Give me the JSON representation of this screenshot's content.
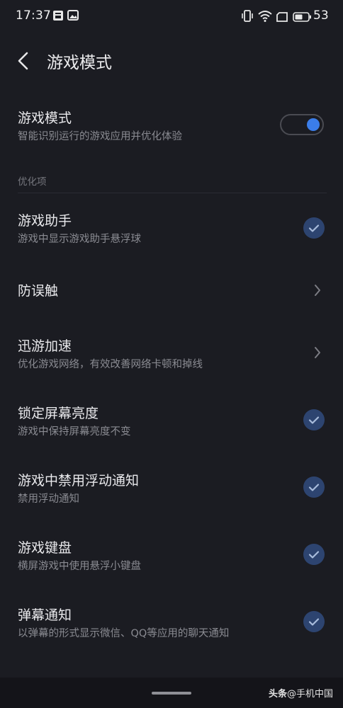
{
  "status_bar": {
    "time": "17:37",
    "battery_level": "53",
    "icons": [
      "notification-app-icon",
      "image-notification-icon",
      "vibrate-icon",
      "wifi-icon",
      "sim-card-icon",
      "battery-icon"
    ]
  },
  "header": {
    "back_icon": "back-arrow-icon",
    "title": "游戏模式"
  },
  "game_mode": {
    "title": "游戏模式",
    "subtitle": "智能识别运行的游戏应用并优化体验",
    "enabled": true
  },
  "section": {
    "label": "优化项"
  },
  "items": [
    {
      "title": "游戏助手",
      "subtitle": "游戏中显示游戏助手悬浮球",
      "control": "check",
      "checked": true
    },
    {
      "title": "防误触",
      "subtitle": "",
      "control": "chevron"
    },
    {
      "title": "迅游加速",
      "subtitle": "优化游戏网络，有效改善网络卡顿和掉线",
      "control": "chevron"
    },
    {
      "title": "锁定屏幕亮度",
      "subtitle": "游戏中保持屏幕亮度不变",
      "control": "check",
      "checked": true
    },
    {
      "title": "游戏中禁用浮动通知",
      "subtitle": "禁用浮动通知",
      "control": "check",
      "checked": true
    },
    {
      "title": "游戏键盘",
      "subtitle": "横屏游戏中使用悬浮小键盘",
      "control": "check",
      "checked": true
    },
    {
      "title": "弹幕通知",
      "subtitle": "以弹幕的形式显示微信、QQ等应用的聊天通知",
      "control": "check",
      "checked": true
    }
  ],
  "watermark": {
    "source": "头条",
    "author": "@手机中国"
  },
  "colors": {
    "background": "#1b1c22",
    "accent": "#3b7de9",
    "check_background": "#2d4470"
  }
}
